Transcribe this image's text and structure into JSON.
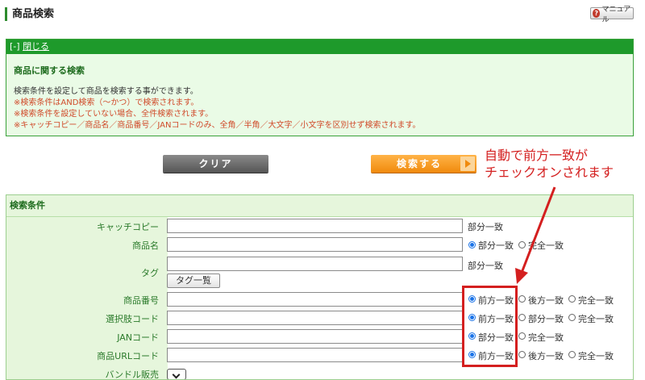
{
  "header": {
    "title": "商品検索",
    "manual_label": "マニュアル",
    "manual_icon_glyph": "?"
  },
  "info": {
    "close_prefix": "[-]",
    "close_label": "閉じる",
    "heading": "商品に関する検索",
    "lines": [
      "検索条件を設定して商品を検索する事ができます。",
      "※検索条件はAND検索（〜かつ）で検索されます。",
      "※検索条件を設定していない場合、全件検索されます。",
      "※キャッチコピー／商品名／商品番号／JANコードのみ、全角／半角／大文字／小文字を区別せず検索されます。"
    ]
  },
  "buttons": {
    "clear_label": "クリア",
    "search_label": "検索する"
  },
  "annotation": {
    "line1": "自動で前方一致が",
    "line2": "チェックオンされます",
    "color": "#d42020"
  },
  "conditions": {
    "heading": "検索条件",
    "rows": [
      {
        "label": "キャッチコピー",
        "options": [
          "部分一致"
        ]
      },
      {
        "label": "商品名",
        "options": [
          "部分一致",
          "完全一致"
        ],
        "selected": 0
      },
      {
        "label": "タグ",
        "options": [
          "部分一致"
        ],
        "button": "タグ一覧"
      },
      {
        "label": "商品番号",
        "options": [
          "前方一致",
          "後方一致",
          "完全一致"
        ],
        "selected": 0
      },
      {
        "label": "選択肢コード",
        "options": [
          "前方一致",
          "部分一致",
          "完全一致"
        ],
        "selected": 0
      },
      {
        "label": "JANコード",
        "options": [
          "部分一致",
          "完全一致"
        ],
        "selected": 0
      },
      {
        "label": "商品URLコード",
        "options": [
          "前方一致",
          "後方一致",
          "完全一致"
        ],
        "selected": 0
      },
      {
        "label": "バンドル販売"
      }
    ]
  }
}
